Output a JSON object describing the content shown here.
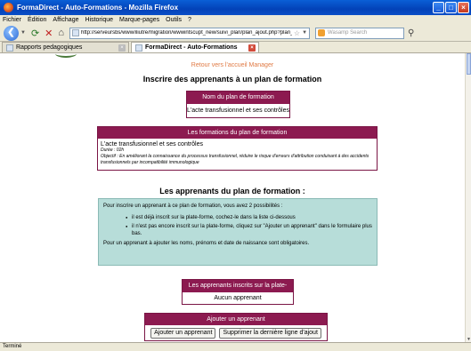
{
  "window": {
    "title": "FormaDirect - Auto-Formations - Mozilla Firefox",
    "buttons": {
      "minimize": "_",
      "maximize": "□",
      "close": "×"
    }
  },
  "menu": [
    "Fichier",
    "Édition",
    "Affichage",
    "Historique",
    "Marque-pages",
    "Outils",
    "?"
  ],
  "nav": {
    "url": "http://serveursbs/www/iliutre/migration/wwwintscupt_new/suivi_plan/plan_ajout.php?plan_modele_id=",
    "search_placeholder": "Wasamp Search"
  },
  "tabs": [
    {
      "label": "Rapports pedagogiques",
      "active": false
    },
    {
      "label": "FormaDirect - Auto-Formations",
      "active": true
    }
  ],
  "page": {
    "back_link": "Retour vers l'accueil Manager",
    "heading": "Inscrire des apprenants à un plan de formation",
    "plan_name_box": {
      "header": "Nom du plan de formation",
      "value": "L'acte transfusionnel et ses contrôles"
    },
    "formations_box": {
      "header": "Les formations du plan de formation",
      "title": "L'acte transfusionnel et ses contrôles",
      "duree": "Durée : 02h",
      "objectif": "Objectif : En améliorant la connaissance du processus transfusionnel, réduire le risque d'erreurs d'attribution conduisant à des accidents transfusionnels par incompatibilité immunologique"
    },
    "apprenants_heading": "Les apprenants du plan de formation :",
    "info": {
      "intro": "Pour inscrire un apprenant à ce plan de formation, vous avez 2 possibilités :",
      "items": [
        "il est déjà inscrit sur la plate-forme, cochez-le dans la liste ci-dessous",
        "il n'est pas encore inscrit sur la plate-forme, cliquez sur \"Ajouter un apprenant\" dans le formulaire plus bas."
      ],
      "footer": "Pour un apprenant à ajouter les noms, prénoms et date de naissance sont obligatoires."
    },
    "inscrits_box": {
      "header": "Les apprenants inscrits sur la plate-forme",
      "value": "Aucun apprenant"
    },
    "ajout_box": {
      "header": "Ajouter un apprenant",
      "add_button": "Ajouter un apprenant",
      "delete_button": "Supprimer la dernière ligne d'ajout"
    }
  },
  "status": "Terminé"
}
